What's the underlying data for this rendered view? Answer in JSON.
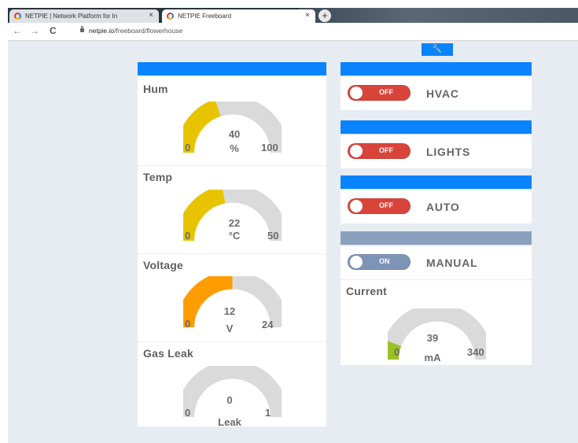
{
  "browser": {
    "tabs": [
      {
        "title": "NETPIE | Network Platform for In",
        "close": "×"
      },
      {
        "title": "NETPIE Freeboard",
        "close": "×"
      }
    ],
    "new_tab": "+",
    "nav": {
      "back": "←",
      "forward": "→",
      "reload": "C"
    },
    "url_domain": "netpie.io",
    "url_path": "/freeboard/flowerhouse"
  },
  "toolbar": {
    "settings_icon": "wrench-icon",
    "settings_glyph": "🔧"
  },
  "colors": {
    "accent": "#0a83ff",
    "gauge_yellow": "#e8c400",
    "gauge_orange": "#ff9d00",
    "gauge_green": "#9bc224",
    "gauge_track": "#dadada",
    "off_red": "#d9443a",
    "on_gray": "#7d94b6"
  },
  "gauges": [
    {
      "title": "Hum",
      "value": 40,
      "unit": "%",
      "min": 0,
      "max": 100,
      "color": "#e8c400"
    },
    {
      "title": "Temp",
      "value": 22,
      "unit": "°C",
      "min": 0,
      "max": 50,
      "color": "#e8c400"
    },
    {
      "title": "Voltage",
      "value": 12,
      "unit": "V",
      "min": 0,
      "max": 24,
      "color": "#ff9d00"
    },
    {
      "title": "Gas Leak",
      "value": 0,
      "unit": "Leak",
      "min": 0,
      "max": 1,
      "color": "#e8c400"
    }
  ],
  "toggles": [
    {
      "label": "HVAC",
      "state": "OFF",
      "on": false
    },
    {
      "label": "LIGHTS",
      "state": "OFF",
      "on": false
    },
    {
      "label": "AUTO",
      "state": "OFF",
      "on": false
    },
    {
      "label": "MANUAL",
      "state": "ON",
      "on": true
    }
  ],
  "current": {
    "title": "Current",
    "value": 39,
    "unit": "mA",
    "min": 0,
    "max": 340,
    "color": "#9bc224"
  }
}
